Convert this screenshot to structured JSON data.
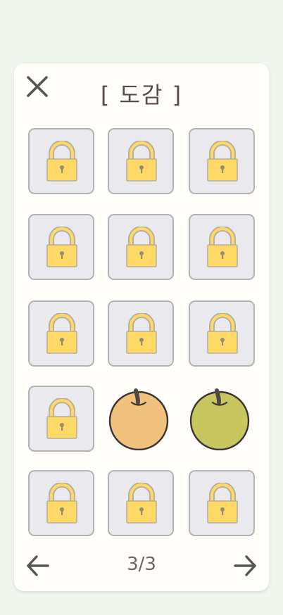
{
  "screen": {
    "background": "#f1f7ef"
  },
  "modal": {
    "title": "[ 도감 ]",
    "close_icon": "close-x-icon",
    "page_indicator": "3/3",
    "prev_icon": "arrow-left-icon",
    "next_icon": "arrow-right-icon"
  },
  "collection": {
    "columns": 3,
    "rows": 5,
    "items": [
      {
        "state": "locked",
        "icon": "lock-icon"
      },
      {
        "state": "locked",
        "icon": "lock-icon"
      },
      {
        "state": "locked",
        "icon": "lock-icon"
      },
      {
        "state": "locked",
        "icon": "lock-icon"
      },
      {
        "state": "locked",
        "icon": "lock-icon"
      },
      {
        "state": "locked",
        "icon": "lock-icon"
      },
      {
        "state": "locked",
        "icon": "lock-icon"
      },
      {
        "state": "locked",
        "icon": "lock-icon"
      },
      {
        "state": "locked",
        "icon": "lock-icon"
      },
      {
        "state": "locked",
        "icon": "lock-icon"
      },
      {
        "state": "unlocked",
        "icon": "pear-icon",
        "color": "#f0c27e"
      },
      {
        "state": "unlocked",
        "icon": "pear-icon",
        "color": "#c8c65e"
      },
      {
        "state": "locked",
        "icon": "lock-icon"
      },
      {
        "state": "locked",
        "icon": "lock-icon"
      },
      {
        "state": "locked",
        "icon": "lock-icon"
      }
    ]
  },
  "colors": {
    "tile_bg": "#e9e9ee",
    "tile_border": "#b3b3b3",
    "lock_body": "#ffd966",
    "lock_shackle_outer": "#b8b0a0",
    "lock_shackle_inner": "#ffd966",
    "title_text": "#5a4a4a"
  }
}
